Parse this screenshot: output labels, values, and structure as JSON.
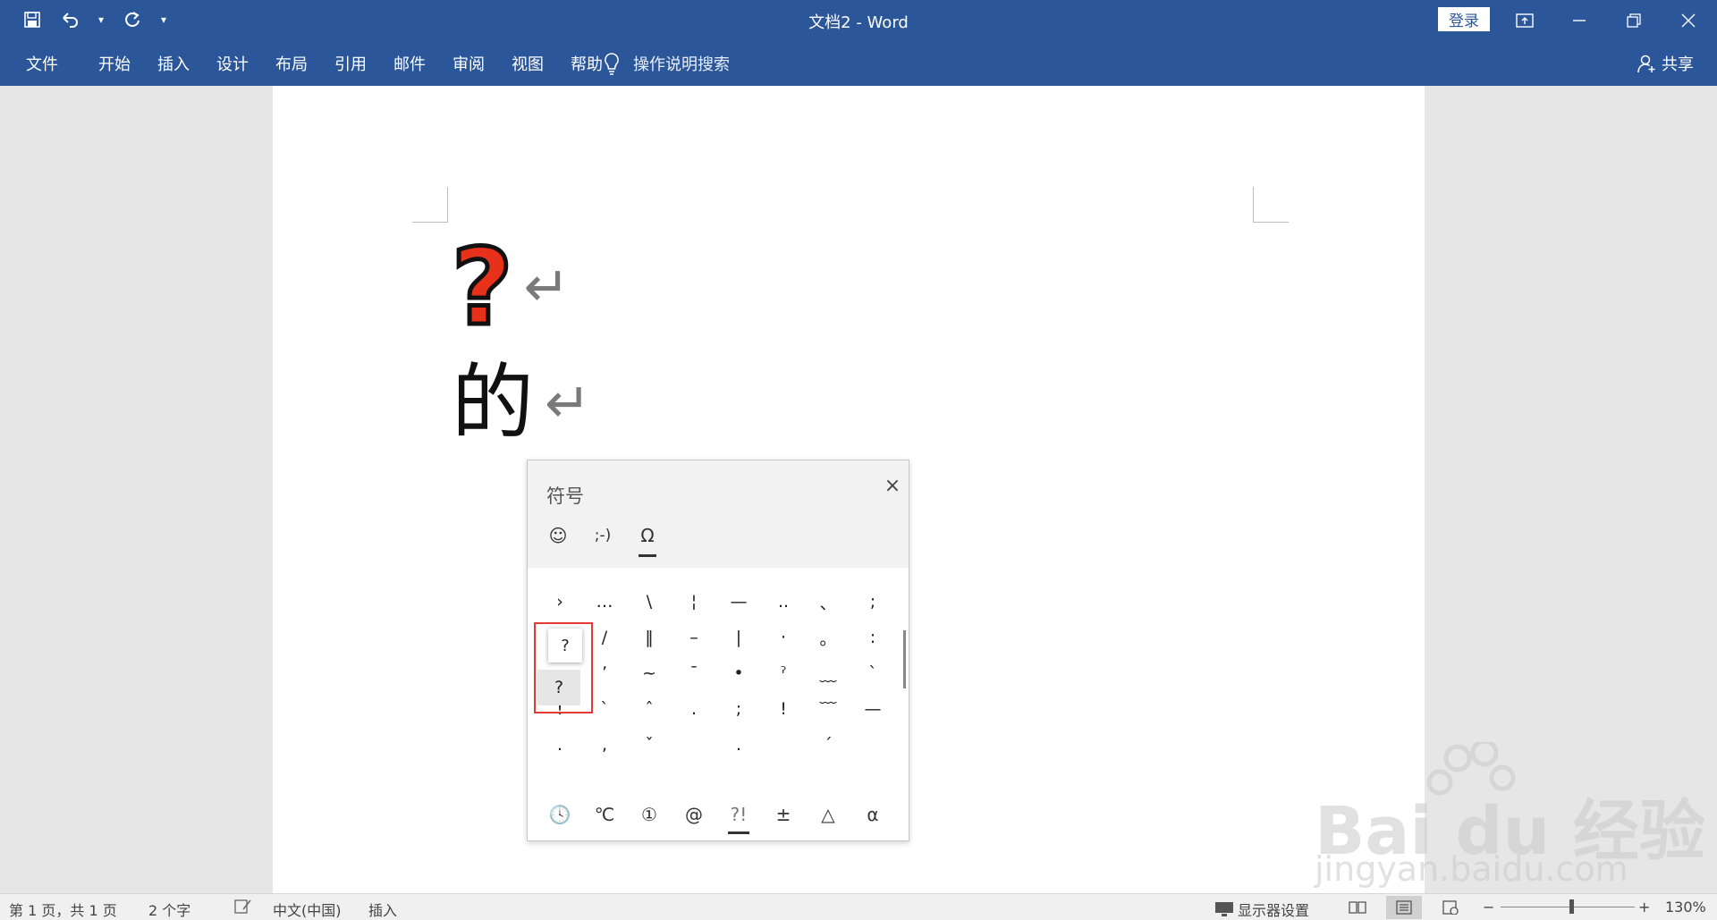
{
  "window": {
    "title": "文档2  -  Word",
    "login_label": "登录",
    "ribbon_display_icon": "ribbon-display-icon",
    "minimize_icon": "minimize-icon",
    "restore_icon": "restore-icon",
    "close_icon": "close-icon"
  },
  "quick_access": {
    "save_icon": "save-icon",
    "undo_icon": "undo-icon",
    "redo_icon": "redo-icon",
    "customize_icon": "customize-icon"
  },
  "ribbon": {
    "tabs": [
      "文件",
      "开始",
      "插入",
      "设计",
      "布局",
      "引用",
      "邮件",
      "审阅",
      "视图",
      "帮助"
    ],
    "tell_me": "操作说明搜索",
    "share": "共享"
  },
  "document": {
    "line1": "?",
    "line2": "的",
    "paragraph_mark": "↵"
  },
  "symbol_panel": {
    "title": "符号",
    "close": "×",
    "category_tabs": [
      "☺",
      ";-)",
      "Ω"
    ],
    "rows": [
      [
        "ˈ",
        "ˈ",
        "·",
        "·",
        "·",
        "",
        "",
        ""
      ],
      [
        "›",
        "…",
        "\\",
        "¦",
        "—",
        "..",
        "、",
        ";"
      ],
      [
        "",
        "/",
        "‖",
        "–",
        "|",
        "·",
        "。",
        ":"
      ],
      [
        "",
        "ʼ",
        "~",
        "ˉ",
        "•",
        "ˀ",
        "﹏",
        "ˋ"
      ],
      [
        "!",
        "ˋ",
        "ˆ",
        ".",
        ";",
        "!",
        "﹋",
        "—"
      ],
      [
        ".",
        ",",
        "ˇ",
        "",
        ".",
        "",
        "ˊ",
        ""
      ]
    ],
    "tooltip_symbol": "?",
    "selected_symbol": "?",
    "sub_tabs": [
      "🕓",
      "℃",
      "①",
      "@",
      "?!",
      "±",
      "△",
      "α"
    ]
  },
  "status": {
    "page": "第 1 页，共 1 页",
    "words": "2 个字",
    "language": "中文(中国)",
    "mode": "插入",
    "display_settings": "显示器设置",
    "zoom_minus": "−",
    "zoom_plus": "+",
    "zoom": "130%"
  },
  "watermark": {
    "brand": "Bai du 经验",
    "url": "jingyan.baidu.com"
  }
}
